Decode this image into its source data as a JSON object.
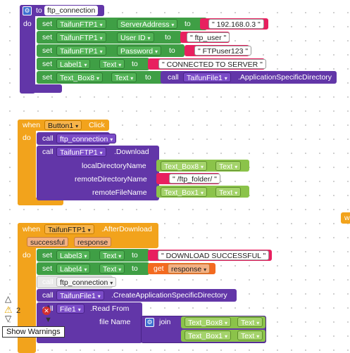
{
  "colors": {
    "procedure": "#6236a8",
    "component_set": "#3f9f45",
    "event": "#f2a31c",
    "text_string": "#e8205f",
    "component_get": "#8bc34a",
    "get_var": "#f36a20"
  },
  "proc": {
    "to": "to",
    "name": "ftp_connection",
    "do": "do"
  },
  "rows": [
    {
      "set": "set",
      "comp": "TaifunFTP1",
      "prop": "ServerAddress",
      "to": "to",
      "value": "192.168.0.3"
    },
    {
      "set": "set",
      "comp": "TaifunFTP1",
      "prop": "User ID",
      "to": "to",
      "value": "ftp_user"
    },
    {
      "set": "set",
      "comp": "TaifunFTP1",
      "prop": "Password",
      "to": "to",
      "value": "FTPuser123"
    },
    {
      "set": "set",
      "comp": "Label1",
      "prop": "Text",
      "to": "to",
      "value": "CONNECTED TO SERVER"
    }
  ],
  "row5": {
    "set": "set",
    "comp": "Text_Box8",
    "prop": "Text",
    "to": "to",
    "call": "call",
    "target": "TaifunFile1",
    "method": ".ApplicationSpecificDirectory"
  },
  "ev1": {
    "when": "when",
    "comp": "Button1",
    "event": "Click",
    "do": "do",
    "call1": "call",
    "proc": "ftp_connection",
    "call2": "call",
    "comp2": "TaifunFTP1",
    "method": ".Download",
    "p1": "localDirectoryName",
    "p2": "remoteDirectoryName",
    "p3": "remoteFileName",
    "v1comp": "Text_Box8",
    "v1prop": "Text",
    "v2": "/ftp_folder/",
    "v3comp": "Text_Box1",
    "v3prop": "Text"
  },
  "ev2": {
    "when": "when",
    "comp": "TaifunFTP1",
    "event": ".AfterDownload",
    "param1": "successful",
    "param2": "response",
    "do": "do",
    "r1set": "set",
    "r1comp": "Label3",
    "r1prop": "Text",
    "r1to": "to",
    "r1val": "DOWNLOAD SUCCESSFUL",
    "r2set": "set",
    "r2comp": "Label4",
    "r2prop": "Text",
    "r2to": "to",
    "r2get": "get",
    "r2var": "response",
    "c1": "call",
    "c1proc": "ftp_connection",
    "c2": "call",
    "c2comp": "TaifunFile1",
    "c2method": ".CreateApplicationSpecificDirectory",
    "c3": "call",
    "c3comp": "File1",
    "c3method": ".Read From",
    "c3param": "file Name",
    "join": "join",
    "j1comp": "Text_Box8",
    "j1prop": "Text",
    "j2comp": "Text_Box1",
    "j2prop": "Text"
  },
  "warnings": {
    "count": "2",
    "tooltip": "Show Warnings"
  },
  "edge_block": {
    "label": "w"
  },
  "icons": {
    "gear": "gear-icon",
    "dropdown": "dropdown-arrow-icon",
    "warning": "warning-icon",
    "error": "error-icon",
    "up": "arrow-up-icon",
    "down": "arrow-down-icon"
  }
}
